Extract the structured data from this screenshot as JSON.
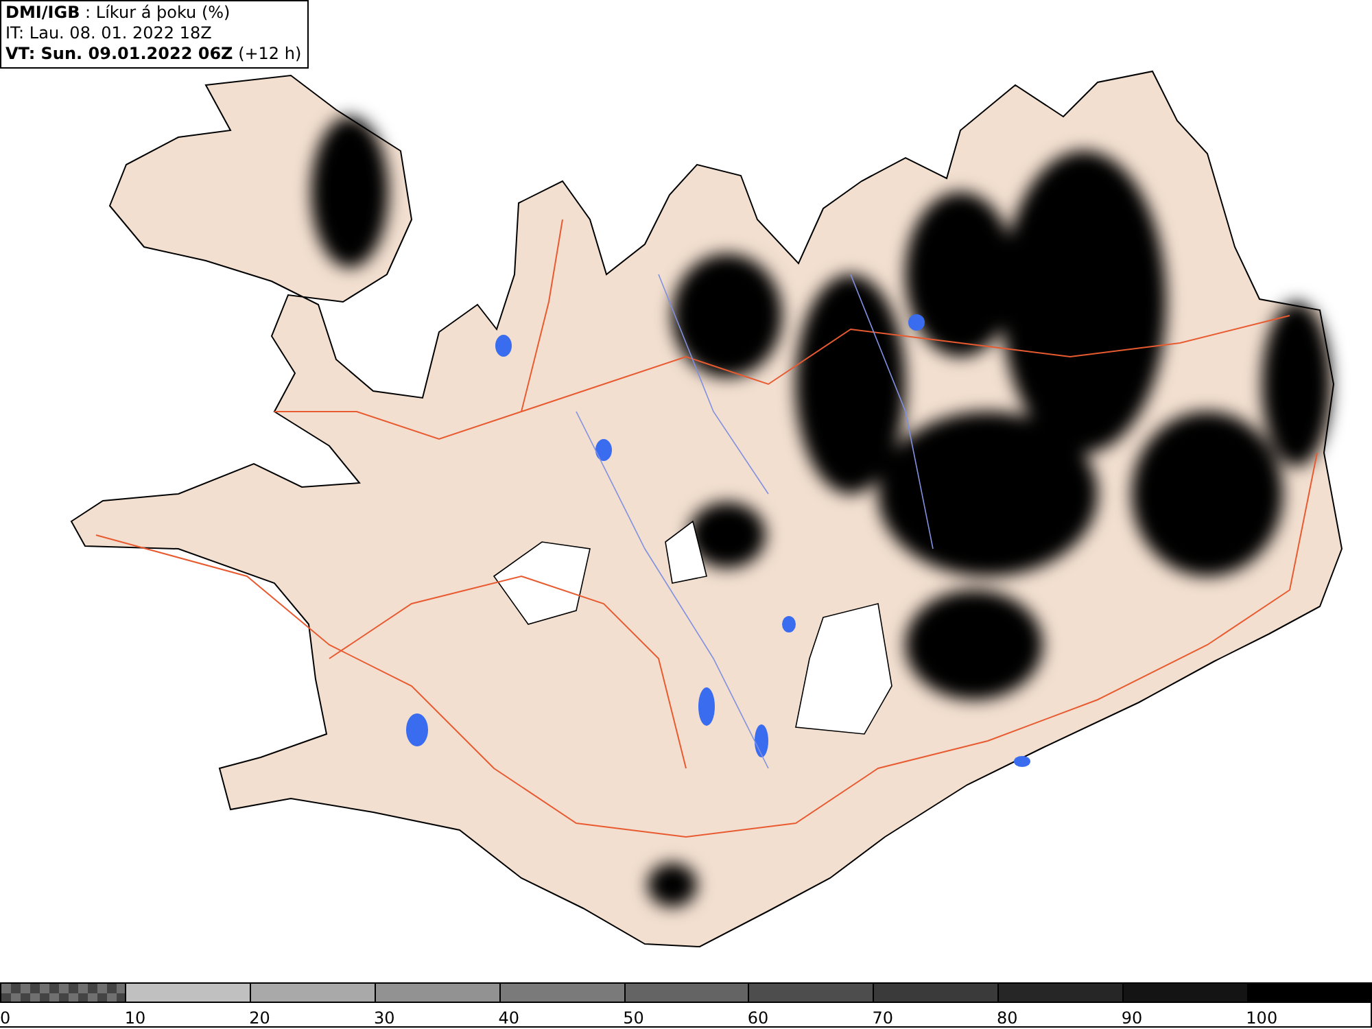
{
  "header": {
    "lines": [
      "**DMI/IGB** : Líkur á þoku (%)",
      "IT: Lau. 08. 01. 2022 18Z",
      "**VT: Sun. 09.01.2022 06Z** (+12 h)"
    ]
  },
  "legend": {
    "segments": [
      {
        "label": "0",
        "color": "#707070",
        "kind": "checker"
      },
      {
        "label": "10",
        "color": "#c0c0c0",
        "kind": "solid"
      },
      {
        "label": "20",
        "color": "#a9a9a9",
        "kind": "solid"
      },
      {
        "label": "30",
        "color": "#929292",
        "kind": "solid"
      },
      {
        "label": "40",
        "color": "#7a7a7a",
        "kind": "solid"
      },
      {
        "label": "50",
        "color": "#646464",
        "kind": "solid"
      },
      {
        "label": "60",
        "color": "#4d4d4d",
        "kind": "solid"
      },
      {
        "label": "70",
        "color": "#3a3a3a",
        "kind": "solid"
      },
      {
        "label": "80",
        "color": "#262626",
        "kind": "solid"
      },
      {
        "label": "90",
        "color": "#141414",
        "kind": "solid"
      },
      {
        "label": "100",
        "color": "#000000",
        "kind": "solid"
      }
    ]
  }
}
